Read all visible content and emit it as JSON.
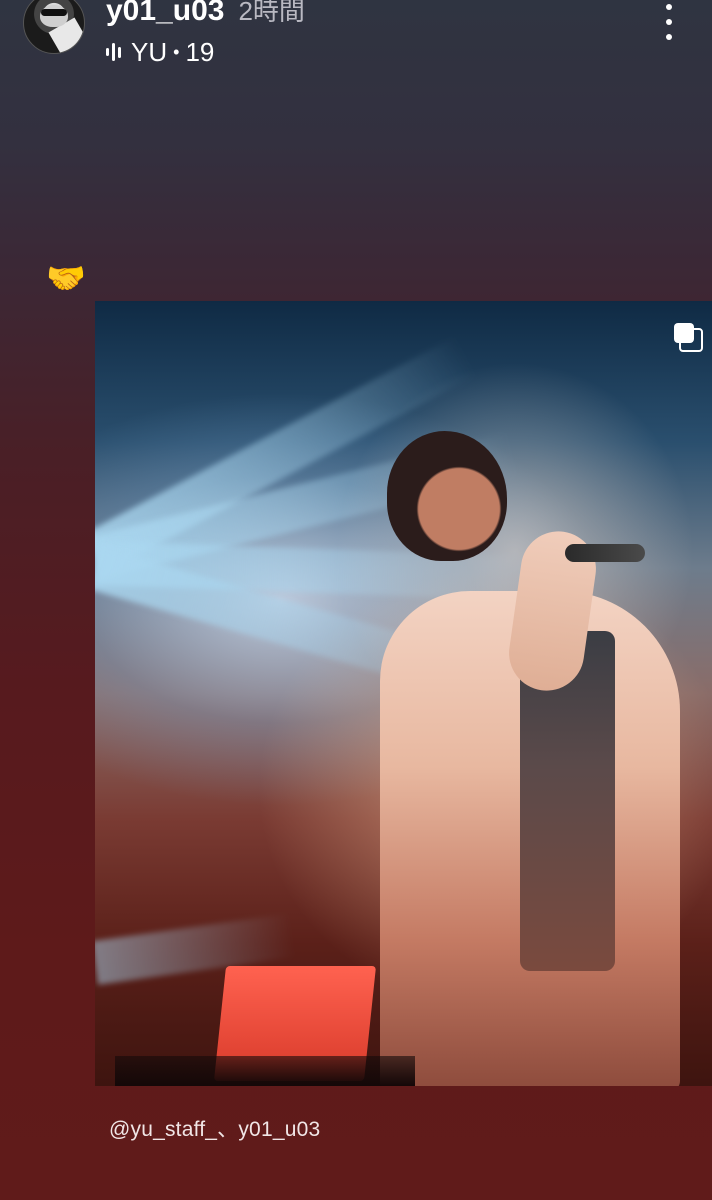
{
  "header": {
    "username": "y01_u03",
    "time_ago": "2時間",
    "music": {
      "icon": "music-wave-icon",
      "artist": "YU",
      "separator": "•",
      "track": "19"
    },
    "more_icon": "more-vertical-icon"
  },
  "story": {
    "sticker_emoji": "🤝",
    "carousel_icon": "multiple-photos-icon",
    "mentions": "@yu_staff_、y01_u03"
  }
}
